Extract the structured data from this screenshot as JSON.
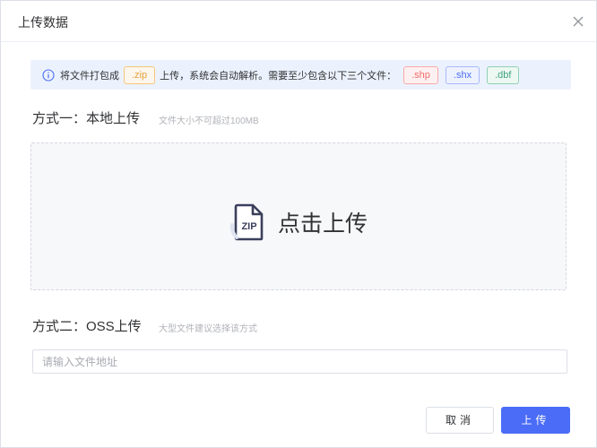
{
  "dialog": {
    "title": "上传数据",
    "close_icon": "close-icon"
  },
  "alert": {
    "icon": "info-icon",
    "text_before": "将文件打包成",
    "zip_tag": ".zip",
    "text_after": "上传，系统会自动解析。需要至少包含以下三个文件：",
    "file_tags": [
      ".shp",
      ".shx",
      ".dbf"
    ]
  },
  "method_local": {
    "title": "方式一：本地上传",
    "hint": "文件大小不可超过100MB",
    "dropzone_icon": "zip-file-icon",
    "zip_icon_text": "ZIP",
    "dropzone_label": "点击上传"
  },
  "method_oss": {
    "title": "方式二：OSS上传",
    "hint": "大型文件建议选择该方式",
    "input_value": "",
    "input_placeholder": "请输入文件地址"
  },
  "footer": {
    "cancel_label": "取消",
    "upload_label": "上传"
  },
  "colors": {
    "primary": "#4a6cf7",
    "alert_bg": "#ecf2fd",
    "zip_tag": "#e6a23c",
    "shp_tag": "#f56c6c",
    "shx_tag": "#4a6cf7",
    "dbf_tag": "#3ea57a"
  }
}
